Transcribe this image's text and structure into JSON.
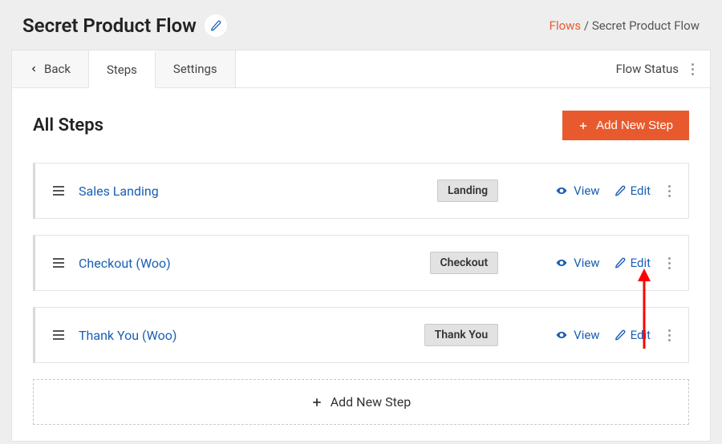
{
  "header": {
    "title": "Secret Product Flow"
  },
  "breadcrumb": {
    "link_label": "Flows",
    "separator": " / ",
    "current": "Secret Product Flow"
  },
  "tabs": {
    "back": "Back",
    "steps": "Steps",
    "settings": "Settings",
    "flow_status": "Flow Status"
  },
  "content": {
    "title": "All Steps",
    "add_button": "Add New Step",
    "add_row": "Add New Step"
  },
  "actions": {
    "view": "View",
    "edit": "Edit"
  },
  "steps": [
    {
      "name": "Sales Landing",
      "type": "Landing"
    },
    {
      "name": "Checkout (Woo)",
      "type": "Checkout"
    },
    {
      "name": "Thank You (Woo)",
      "type": "Thank You"
    }
  ]
}
